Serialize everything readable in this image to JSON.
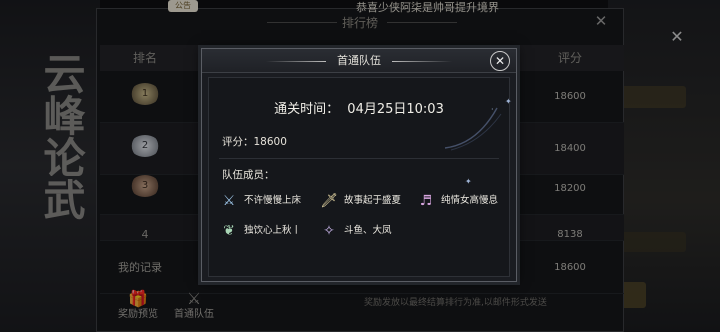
{
  "background": {
    "calligraphy": "云峰论武",
    "notice_tab": "公告",
    "broadcast": "恭喜少侠阿柒是帅哥提升境界",
    "right_close": "✕"
  },
  "leaderboard": {
    "title": "排行榜",
    "close": "✕",
    "columns": {
      "rank": "排名",
      "score": "评分"
    },
    "rows": [
      {
        "rank": "1",
        "score": "18600"
      },
      {
        "rank": "2",
        "score": "18400"
      },
      {
        "rank": "3",
        "score": "18200"
      },
      {
        "rank": "4",
        "score": "8138"
      }
    ],
    "my_record": {
      "label": "我的记录",
      "score": "18600"
    },
    "tools": [
      {
        "label": "奖励预览",
        "icon": "gift-icon"
      },
      {
        "label": "首通队伍",
        "icon": "team-icon"
      }
    ],
    "footnote": "奖励发放以最终结算排行为准,以邮件形式发送"
  },
  "modal": {
    "title": "首通队伍",
    "close": "✕",
    "clear_time_label": "通关时间：",
    "clear_time_value": "04月25日10:03",
    "score_label": "评分：",
    "score_value": "18600",
    "members_label": "队伍成员：",
    "members": [
      {
        "name": "不许慢慢上床",
        "icon": "sword-class-icon",
        "color": "#9bc3e6"
      },
      {
        "name": "故事起于盛夏",
        "icon": "blade-class-icon",
        "color": "#e8d9a6"
      },
      {
        "name": "纯情女高慢息",
        "icon": "music-class-icon",
        "color": "#d8a6e0"
      },
      {
        "name": "独饮心上秋丨",
        "icon": "healer-class-icon",
        "color": "#a9d6b6"
      },
      {
        "name": "斗鱼、大凤",
        "icon": "dagger-class-icon",
        "color": "#c7b4e8"
      }
    ]
  }
}
